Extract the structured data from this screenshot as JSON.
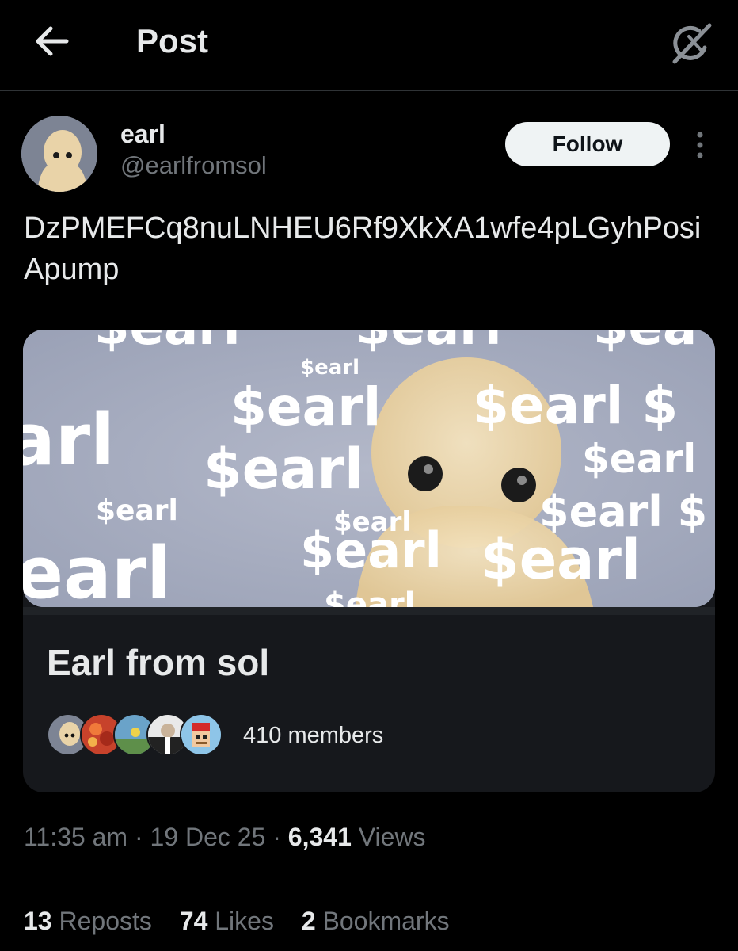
{
  "colors": {
    "background": "#000000",
    "text_primary": "#e7e9ea",
    "text_secondary": "#71767b",
    "divider": "#2f3336",
    "follow_button_bg": "#eff3f4",
    "follow_button_text": "#0f1419",
    "card_bg": "#16181c"
  },
  "header": {
    "back_icon": "arrow-left-icon",
    "title": "Post",
    "grok_icon": "grok-icon"
  },
  "author": {
    "avatar_icon": "avatar-earl",
    "display_name": "earl",
    "handle": "@earlfromsol",
    "follow_label": "Follow",
    "more_icon": "more-vertical-icon"
  },
  "post": {
    "text": "DzPMEFCq8nuLNHEU6Rf9XkXA1wfe4pLGyhPosiApump"
  },
  "community_card": {
    "image_watermark_text": "$earl",
    "title": "Earl from sol",
    "member_count": "410 members"
  },
  "meta": {
    "time": "11:35 am",
    "separator": "·",
    "date": "19 Dec 25",
    "views_count": "6,341",
    "views_label": "Views"
  },
  "stats": {
    "reposts_count": "13",
    "reposts_label": "Reposts",
    "likes_count": "74",
    "likes_label": "Likes",
    "bookmarks_count": "2",
    "bookmarks_label": "Bookmarks"
  }
}
